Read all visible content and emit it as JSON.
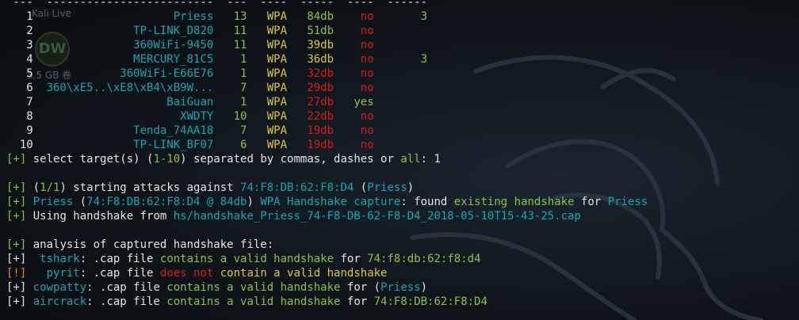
{
  "separator": " ---  -------------------------  ---  ----  -----  ----  ------",
  "networks": [
    {
      "num": "1",
      "essid": "Priess",
      "ch": "13",
      "enc": "WPA",
      "power": "84db",
      "power_color": "#8bc34a",
      "wps": "no",
      "wps_color": "#e01b1b",
      "client": "3"
    },
    {
      "num": "2",
      "essid": "TP-LINK_D820",
      "ch": "11",
      "enc": "WPA",
      "power": "51db",
      "power_color": "#8bc34a",
      "wps": "no",
      "wps_color": "#e01b1b",
      "client": ""
    },
    {
      "num": "3",
      "essid": "360WiFi-9450",
      "ch": "11",
      "enc": "WPA",
      "power": "39db",
      "power_color": "#dcc93c",
      "wps": "no",
      "wps_color": "#e01b1b",
      "client": ""
    },
    {
      "num": "4",
      "essid": "MERCURY_81C5",
      "ch": "1",
      "enc": "WPA",
      "power": "36db",
      "power_color": "#dcc93c",
      "wps": "no",
      "wps_color": "#e01b1b",
      "client": "3"
    },
    {
      "num": "5",
      "essid": "360WiFi-E66E76",
      "ch": "1",
      "enc": "WPA",
      "power": "32db",
      "power_color": "#e01b1b",
      "wps": "no",
      "wps_color": "#e01b1b",
      "client": ""
    },
    {
      "num": "6",
      "essid": "360\\xE5..\\xE8\\xB4\\xB9W...",
      "ch": "7",
      "enc": "WPA",
      "power": "29db",
      "power_color": "#e01b1b",
      "wps": "no",
      "wps_color": "#e01b1b",
      "client": ""
    },
    {
      "num": "7",
      "essid": "BaiGuan",
      "ch": "1",
      "enc": "WPA",
      "power": "27db",
      "power_color": "#e01b1b",
      "wps": "yes",
      "wps_color": "#8bc34a",
      "client": ""
    },
    {
      "num": "8",
      "essid": "XWDTY",
      "ch": "10",
      "enc": "WPA",
      "power": "22db",
      "power_color": "#e01b1b",
      "wps": "no",
      "wps_color": "#e01b1b",
      "client": ""
    },
    {
      "num": "9",
      "essid": "Tenda_74AA18",
      "ch": "7",
      "enc": "WPA",
      "power": "19db",
      "power_color": "#e01b1b",
      "wps": "no",
      "wps_color": "#e01b1b",
      "client": ""
    },
    {
      "num": "10",
      "essid": "TP-LINK_BF07",
      "ch": "6",
      "enc": "WPA",
      "power": "19db",
      "power_color": "#e01b1b",
      "wps": "no",
      "wps_color": "#e01b1b",
      "client": ""
    }
  ],
  "select": {
    "tag": "[+]",
    "text1": " select target(s) (",
    "range": "1-10",
    "text2": ") separated by commas, dashes or ",
    "all": "all",
    "text3": ": ",
    "input": "1"
  },
  "attack": {
    "tag": "[+]",
    "open": " (",
    "progress": "1/1",
    "text": ") starting attacks against ",
    "bssid": "74:F8:DB:62:F8:D4",
    "essid": "Priess"
  },
  "capture": {
    "tag": "[+]",
    "essid": "Priess",
    "bssid_power": "74:F8:DB:62:F8:D4 @ 84db",
    "label": "WPA Handshake capture",
    "found": ": found ",
    "existing": "existing handshake",
    "for": " for ",
    "target": "Priess"
  },
  "using": {
    "tag": "[+]",
    "text": " Using handshake from ",
    "path": "hs/handshake_Priess_74-F8-DB-62-F8-D4_2018-05-10T15-43-25.cap"
  },
  "analysis": {
    "tag": "[+]",
    "text": " analysis of captured handshake file:"
  },
  "tools": [
    {
      "tag": "[+]",
      "tag_color": "#e6e6e6",
      "name": "  tshark",
      "text": ": .cap file ",
      "verdict": "contains a valid handshake",
      "verdict_color": "#8bc34a",
      "for": " for ",
      "target": "74:f8:db:62:f8:d4",
      "target_color": "#8bc34a"
    },
    {
      "tag": "[!]",
      "tag_color": "#e08b2a",
      "name": "   pyrit",
      "text": ": .cap file ",
      "verdict": "does not",
      "verdict_color": "#e01b1b",
      "for": " contain a valid handshake",
      "target": "",
      "target_color": "#dcc93c"
    },
    {
      "tag": "[+]",
      "tag_color": "#e6e6e6",
      "name": " cowpatty",
      "text": ": .cap file ",
      "verdict": "contains a valid handshake",
      "verdict_color": "#8bc34a",
      "for": " for (",
      "target": "Priess",
      "target_color": "#1aa6b0"
    },
    {
      "tag": "[+]",
      "tag_color": "#e6e6e6",
      "name": " aircrack",
      "text": ": .cap file ",
      "verdict": "contains a valid handshake",
      "verdict_color": "#8bc34a",
      "for": " for ",
      "target": "74:F8:DB:62:F8:D4",
      "target_color": "#8bc34a"
    }
  ],
  "desktop": {
    "live_label": "Kali Live",
    "disk_label": "DW",
    "size_label": "3.5 GB 卷"
  },
  "colors": {
    "green": "#8bc34a",
    "yellow": "#dcc93c",
    "red": "#e01b1b",
    "cyan": "#1aa6b0",
    "orange": "#e08b2a",
    "white": "#e6e6e6"
  }
}
